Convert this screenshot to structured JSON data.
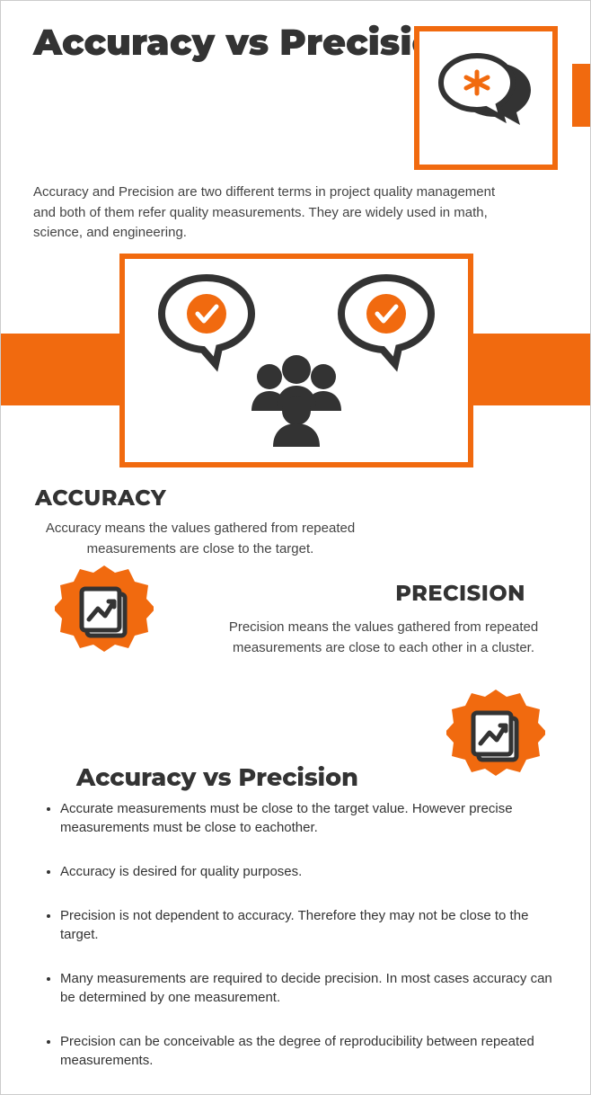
{
  "title": "Accuracy vs Precision",
  "intro": "Accuracy and Precision are two different terms in project quality management and both of them refer quality measurements. They are widely used in math, science, and engineering.",
  "accuracy": {
    "heading": "ACCURACY",
    "text": "Accuracy means the values gathered from repeated measurements are close to the target."
  },
  "precision": {
    "heading": "PRECISION",
    "text": "Precision means the values gathered from repeated measurements are close to each other in a cluster."
  },
  "compare": {
    "heading": "Accuracy vs Precision",
    "bullets": [
      "Accurate measurements must be close to the target value. However precise measurements  must be close to eachother.",
      "Accuracy is desired for quality purposes.",
      "Precision is not dependent to accuracy. Therefore they may not be close to the target.",
      "Many measurements are required to decide precision. In most cases accuracy can be determined by one measurement.",
      "Precision can be conceivable as the degree of reproducibility between repeated measurements."
    ]
  }
}
